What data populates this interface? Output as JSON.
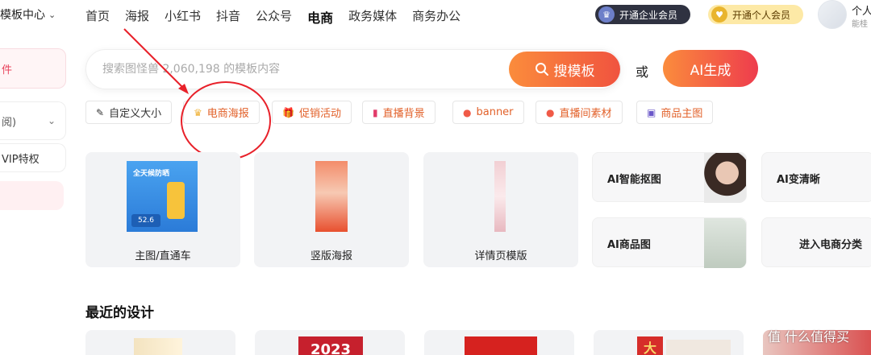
{
  "topbar": {
    "template_center": "模板中心",
    "nav": [
      "首页",
      "海报",
      "小红书",
      "抖音",
      "公众号",
      "电商",
      "政务媒体",
      "商务办公"
    ],
    "active_nav": "电商",
    "enterprise_member": "开通企业会员",
    "personal_member": "开通个人会员",
    "user_name": "个人",
    "user_sub": "能桂"
  },
  "sidebar": {
    "file_label": "件",
    "select_label": "阅)",
    "vip_label": "VIP特权"
  },
  "search": {
    "placeholder": "搜索图怪兽 2,060,198 的模板内容",
    "button": "搜模板",
    "or": "或",
    "ai_button": "AI生成"
  },
  "chips": [
    "自定义大小",
    "电商海报",
    "促销活动",
    "直播背景",
    "banner",
    "直播间素材",
    "商品主图"
  ],
  "cards": [
    "主图/直通车",
    "竖版海报",
    "详情页模版"
  ],
  "ai_cards": [
    "AI智能抠图",
    "AI变清晰",
    "AI商品图",
    "进入电商分类"
  ],
  "recent": {
    "title": "最近的设计",
    "thumb_texts": [
      "2023",
      "大"
    ]
  },
  "thumbs": {
    "sunscreen_title": "全天候防晒",
    "price": "52.6"
  },
  "watermark": "值 什么值得买",
  "colors": {
    "accent_orange": "#fb8c3c",
    "accent_red": "#ee3c4d",
    "annotation_red": "#e8212a"
  }
}
